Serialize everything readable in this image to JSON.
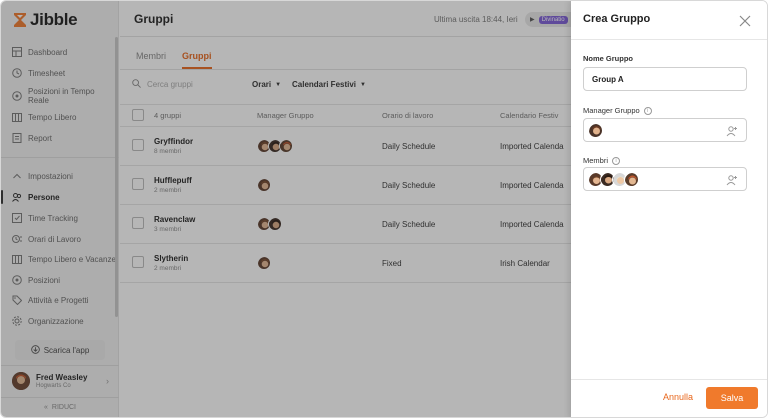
{
  "app": {
    "name": "Jibble"
  },
  "sidebar": {
    "items": [
      {
        "label": "Dashboard",
        "icon": "dashboard-icon"
      },
      {
        "label": "Timesheet",
        "icon": "clock-icon"
      },
      {
        "label": "Posizioni in Tempo Reale",
        "icon": "location-icon"
      },
      {
        "label": "Tempo Libero",
        "icon": "calendar-icon"
      },
      {
        "label": "Report",
        "icon": "report-icon"
      }
    ],
    "settings": [
      {
        "label": "Impostazioni",
        "icon": "chevron-up-icon"
      },
      {
        "label": "Persone",
        "icon": "people-icon",
        "active": true
      },
      {
        "label": "Time Tracking",
        "icon": "time-tracking-icon"
      },
      {
        "label": "Orari di Lavoro",
        "icon": "schedule-icon"
      },
      {
        "label": "Tempo Libero e Vacanze",
        "icon": "calendar-icon"
      },
      {
        "label": "Posizioni",
        "icon": "location-icon"
      },
      {
        "label": "Attività e Progetti",
        "icon": "tag-icon"
      },
      {
        "label": "Organizzazione",
        "icon": "gear-icon"
      }
    ],
    "download_label": "Scarica l'app",
    "user": {
      "name": "Fred Weasley",
      "org": "Hogwarts Co"
    },
    "collapse_label": "RIDUCI"
  },
  "header": {
    "title": "Gruppi",
    "last_out": "Ultima uscita 18:44, Ieri",
    "activity_tag": "Divinatio"
  },
  "tabs": [
    {
      "label": "Membri",
      "active": false
    },
    {
      "label": "Gruppi",
      "active": true
    }
  ],
  "filters": {
    "search_placeholder": "Cerca gruppi",
    "orari": "Orari",
    "calendari": "Calendari Festivi"
  },
  "table": {
    "columns": [
      "4 gruppi",
      "Manager Gruppo",
      "Orario di lavoro",
      "Calendario Festiv"
    ],
    "rows": [
      {
        "name": "Gryffindor",
        "count": "8 membri",
        "schedule": "Daily Schedule",
        "calendar": "Imported Calenda",
        "managers": 3
      },
      {
        "name": "Hufflepuff",
        "count": "2 membri",
        "schedule": "Daily Schedule",
        "calendar": "Imported Calenda",
        "managers": 1
      },
      {
        "name": "Ravenclaw",
        "count": "3 membri",
        "schedule": "Daily Schedule",
        "calendar": "Imported Calenda",
        "managers": 2
      },
      {
        "name": "Slytherin",
        "count": "2 membri",
        "schedule": "Fixed",
        "calendar": "Irish Calendar",
        "managers": 1
      }
    ]
  },
  "drawer": {
    "title": "Crea Gruppo",
    "name_label": "Nome Gruppo",
    "name_value": "Group A",
    "manager_label": "Manager Gruppo",
    "members_label": "Membri",
    "cancel_label": "Annulla",
    "save_label": "Salva"
  },
  "colors": {
    "accent": "#e8671c",
    "save_button": "#f07a2c",
    "tag": "#7c5cd6"
  }
}
